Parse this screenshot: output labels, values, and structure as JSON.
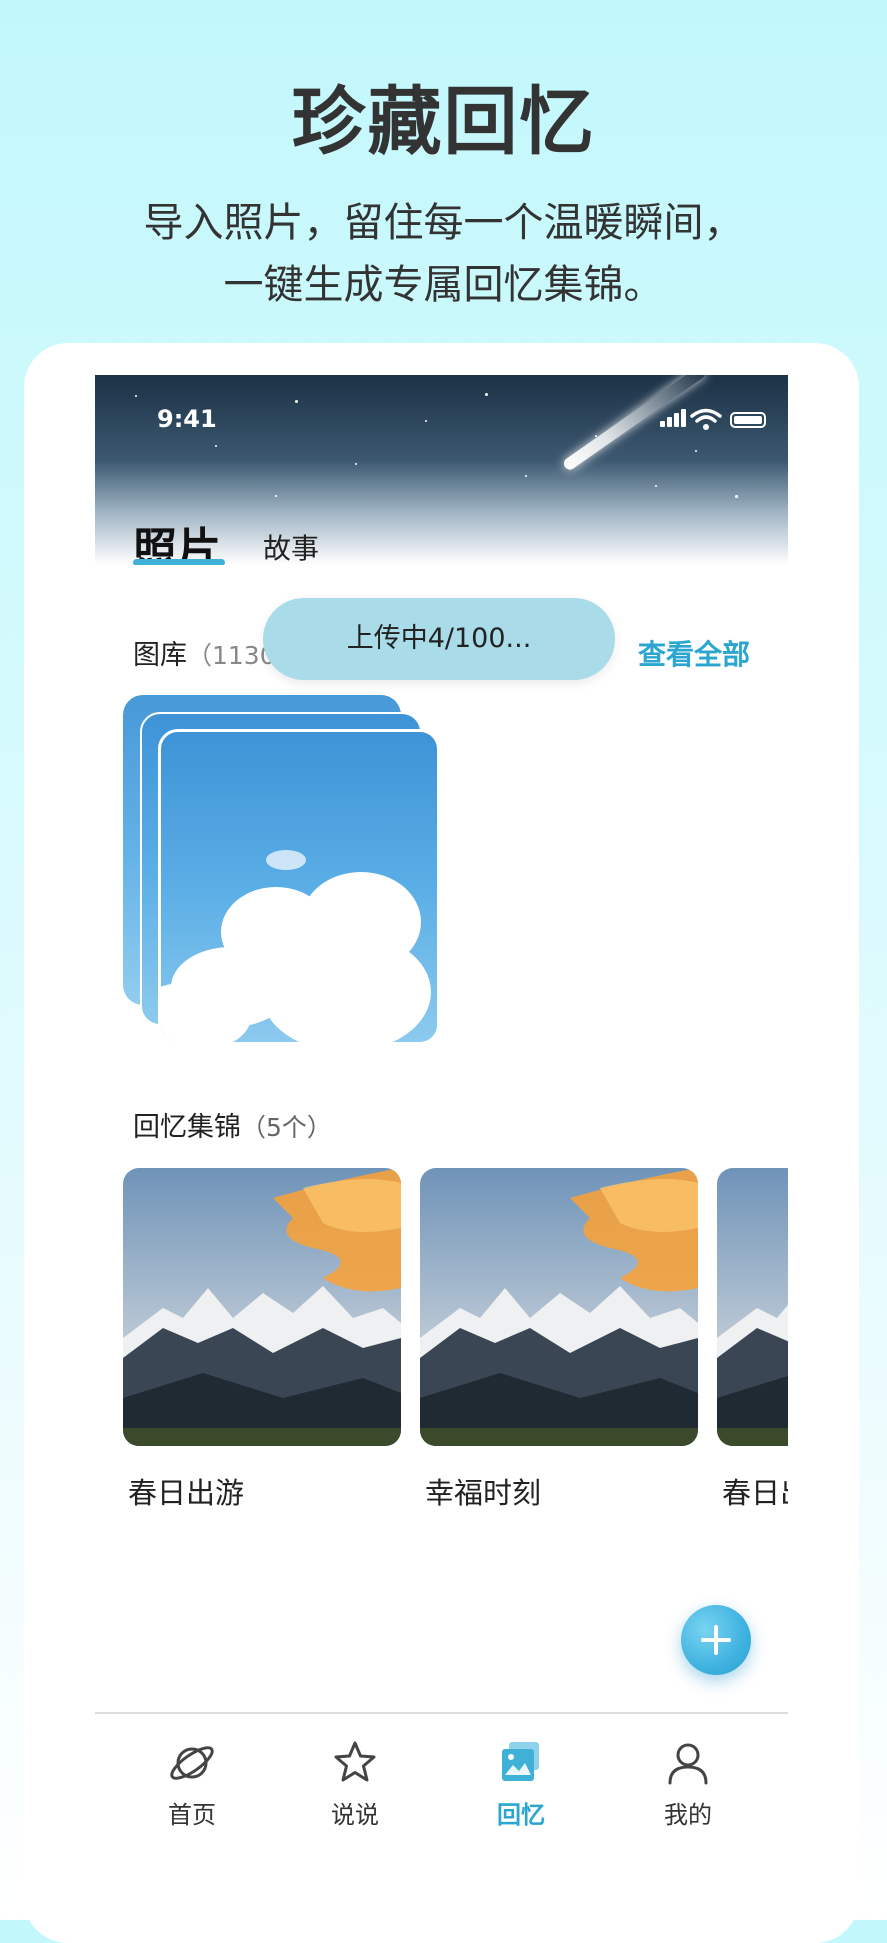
{
  "promo": {
    "title": "珍藏回忆",
    "subtitle_line1": "导入照片，留住每一个温暖瞬间，",
    "subtitle_line2": "一键生成专属回忆集锦。"
  },
  "status_bar": {
    "time": "9:41"
  },
  "top_tabs": {
    "photos": "照片",
    "stories": "故事"
  },
  "gallery": {
    "label": "图库",
    "count": "（1130",
    "view_all": "查看全部"
  },
  "upload_toast": "上传中4/100...",
  "memories": {
    "label": "回忆集锦",
    "count": "（5个）",
    "items": [
      {
        "title": "春日出游"
      },
      {
        "title": "幸福时刻"
      },
      {
        "title": "春日出"
      }
    ]
  },
  "bottom_nav": {
    "items": [
      {
        "label": "首页",
        "icon": "planet-icon",
        "active": false
      },
      {
        "label": "说说",
        "icon": "star-icon",
        "active": false
      },
      {
        "label": "回忆",
        "icon": "gallery-icon",
        "active": true
      },
      {
        "label": "我的",
        "icon": "person-icon",
        "active": false
      }
    ]
  },
  "colors": {
    "accent": "#2aa6d0",
    "toast": "#a9dbe8",
    "background": "#c2f8fc"
  }
}
